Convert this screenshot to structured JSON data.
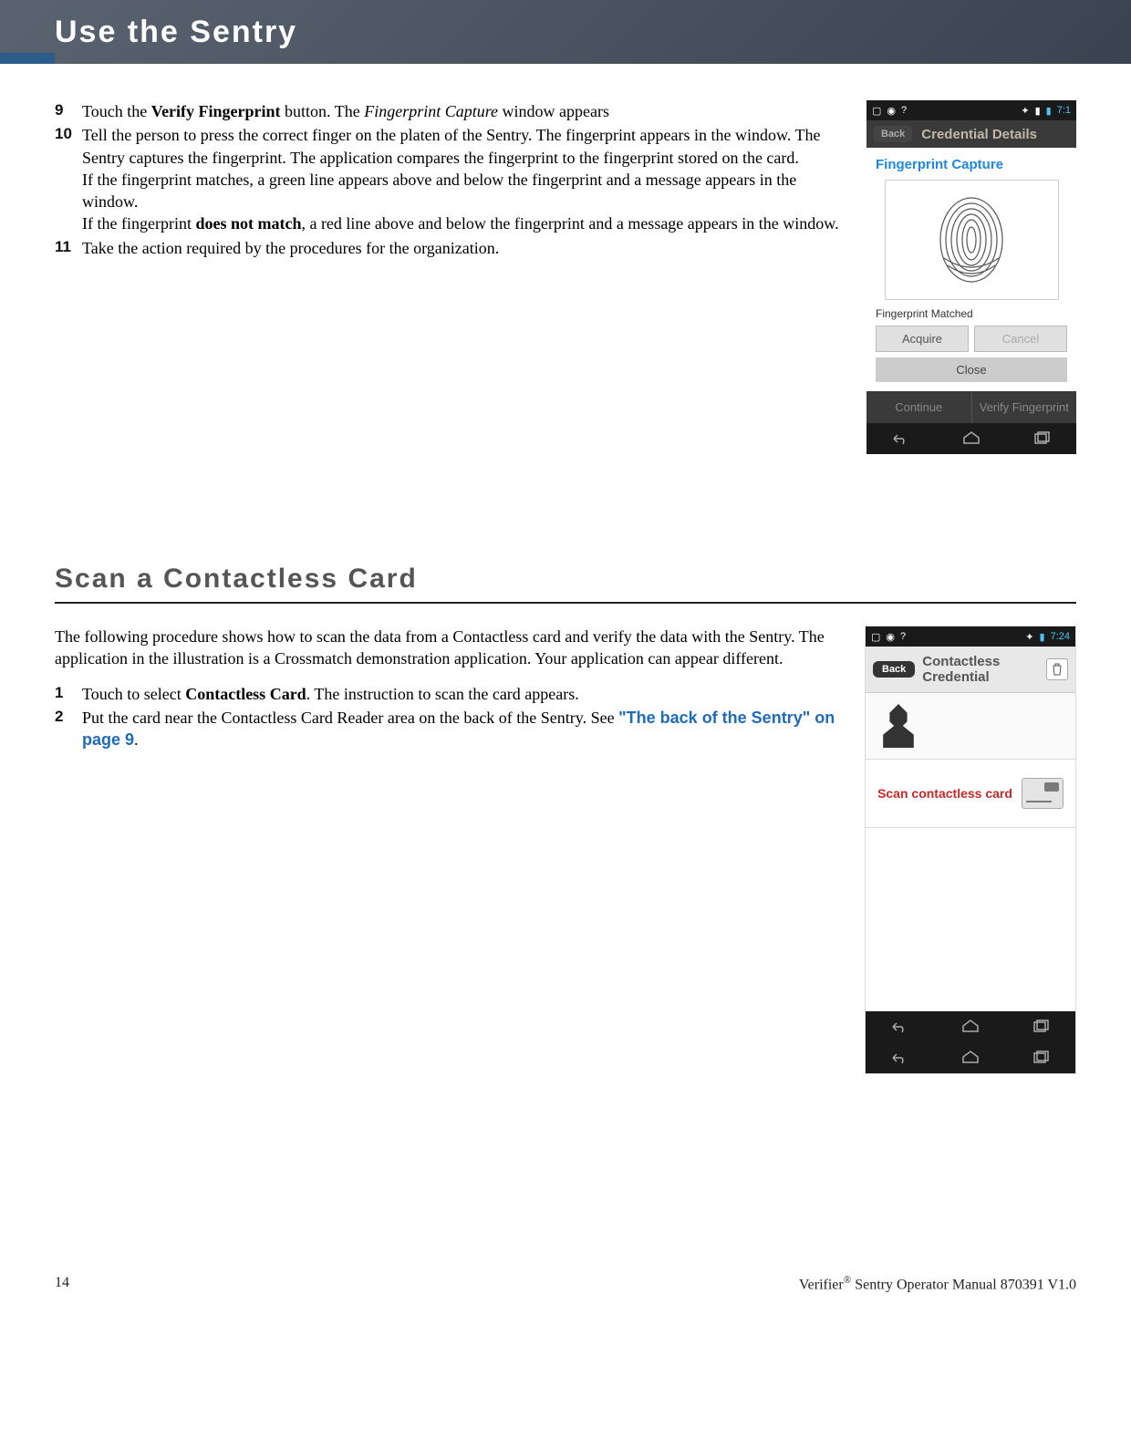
{
  "header": {
    "title": "Use the Sentry"
  },
  "steps_upper": {
    "s9_num": "9",
    "s9_pre": "Touch the ",
    "s9_bold": "Verify Fingerprint",
    "s9_mid": " button. The ",
    "s9_italic": "Fingerprint Capture",
    "s9_end": " window appears",
    "s10_num": "10",
    "s10_line1": "Tell the person to press the correct finger on the platen of the Sentry. The fingerprint appears in the window. The Sentry captures the fingerprint. The application compares the fingerprint to the fingerprint stored on the card.",
    "s10_line2_pre": "If the fingerprint matches, a green line appears above and below the fingerprint and a message appears in the window.",
    "s10_line3_pre": "If the fingerprint ",
    "s10_line3_bold": "does not match",
    "s10_line3_end": ", a red line above and below the fingerprint and a message appears in the window.",
    "s11_num": "11",
    "s11_text": "Take the action required by the procedures for the organization."
  },
  "shot1": {
    "time": "7:1",
    "back": "Back",
    "title": "Credential Details",
    "capture_title": "Fingerprint Capture",
    "matched": "Fingerprint Matched",
    "acquire": "Acquire",
    "cancel": "Cancel",
    "close": "Close",
    "continue": "Continue",
    "verify": "Verify Fingerprint"
  },
  "section2": {
    "heading": "Scan a Contactless Card",
    "intro": "The following procedure shows how to scan the data from a Contactless card and verify the data with the Sentry. The application in the illustration is a Crossmatch demonstration application. Your application can appear different.",
    "s1_num": "1",
    "s1_pre": "Touch to select ",
    "s1_bold": "Contactless Card",
    "s1_end": ". The instruction to scan the card appears.",
    "s2_num": "2",
    "s2_text": "Put the card near the Contactless Card Reader area on the back of the Sentry.  See ",
    "s2_link": "\"The back of the Sentry\" on page 9",
    "s2_period": "."
  },
  "shot2": {
    "time": "7:24",
    "back": "Back",
    "title": "Contactless Credential",
    "instruction": "Scan contactless card"
  },
  "footer": {
    "page": "14",
    "doc_pre": "Verifier",
    "doc_reg": "®",
    "doc_rest": " Sentry Operator Manual 870391 V1.0"
  }
}
